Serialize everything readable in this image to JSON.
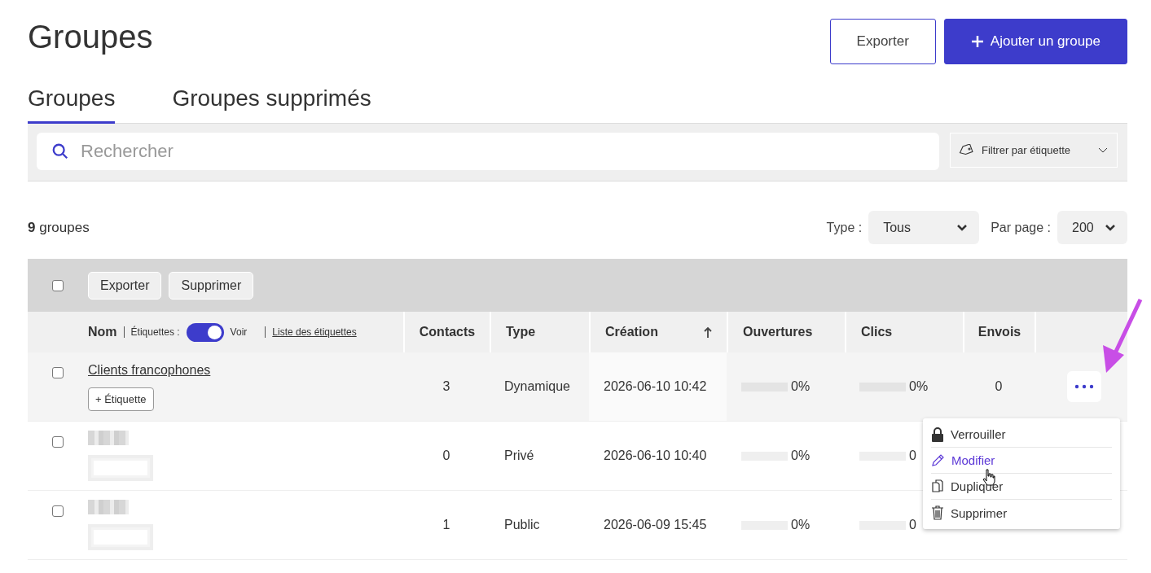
{
  "page": {
    "title": "Groupes"
  },
  "header_buttons": [
    {
      "label": "Exporter",
      "kind": "outline"
    },
    {
      "label": "Ajouter un groupe",
      "kind": "primary"
    }
  ],
  "tabs": [
    {
      "label": "Groupes",
      "selected": true
    },
    {
      "label": "Groupes supprimés",
      "selected": false
    }
  ],
  "search": {
    "placeholder": "Rechercher"
  },
  "tag_filter": {
    "label": "Filtrer par étiquette"
  },
  "count": {
    "number": "9",
    "label": "groupes"
  },
  "type_filter": {
    "label": "Type :",
    "value": "Tous"
  },
  "per_page": {
    "label": "Par page :",
    "value": "200"
  },
  "table": {
    "select_all": {
      "checked": false
    },
    "bulk_actions": [
      "Exporter",
      "Supprimer"
    ],
    "name_header": {
      "label": "Nom",
      "tags_label": "Étiquettes :",
      "tags_visible": true,
      "toggle_label": "Voir",
      "tags_link": "Liste des étiquettes"
    },
    "columns": [
      {
        "label": "Contacts",
        "sorted": false
      },
      {
        "label": "Type",
        "sorted": false
      },
      {
        "label": "Création",
        "sorted": true
      },
      {
        "label": "Ouvertures",
        "sorted": false
      },
      {
        "label": "Clics",
        "sorted": false
      },
      {
        "label": "Envois",
        "sorted": false
      }
    ],
    "rows": [
      {
        "checked": false,
        "highlighted": true,
        "redacted": false,
        "name": "Clients francophones",
        "tag_button": "+ Étiquette",
        "contacts": "3",
        "type": "Dynamique",
        "created": "2026-06-10 10:42",
        "opens": {
          "level": 0,
          "reading": "0%"
        },
        "clicks": {
          "level": 0,
          "reading": "0%"
        },
        "sends": "0"
      },
      {
        "checked": false,
        "highlighted": false,
        "redacted": true,
        "contacts": "0",
        "type": "Privé",
        "created": "2026-06-10 10:40",
        "opens": {
          "level": 0,
          "reading": "0%"
        },
        "clicks": {
          "level": 0,
          "reading": "0"
        }
      },
      {
        "checked": false,
        "highlighted": false,
        "redacted": true,
        "contacts": "1",
        "type": "Public",
        "created": "2026-06-09 15:45",
        "opens": {
          "level": 0,
          "reading": "0%"
        },
        "clicks": {
          "level": 0,
          "reading": "0"
        }
      }
    ]
  },
  "row_menu": {
    "items": [
      {
        "label": "Verrouiller",
        "kind": "lock",
        "highlighted": false
      },
      {
        "label": "Modifier",
        "kind": "edit",
        "highlighted": true
      },
      {
        "label": "Dupliquer",
        "kind": "copy",
        "highlighted": false
      },
      {
        "label": "Supprimer",
        "kind": "delete",
        "highlighted": false
      }
    ]
  }
}
